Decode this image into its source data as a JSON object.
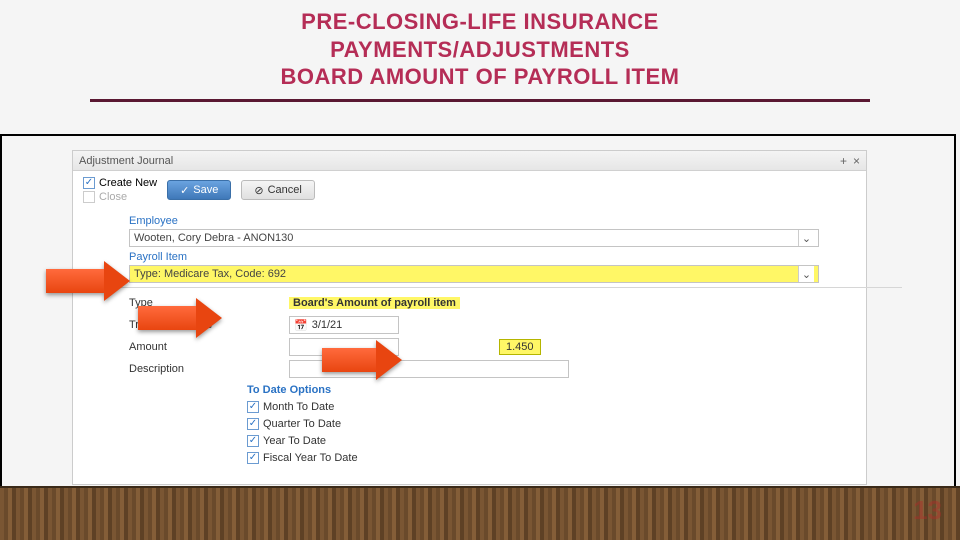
{
  "slide": {
    "title_line1": "PRE-CLOSING-LIFE INSURANCE",
    "title_line2": "PAYMENTS/ADJUSTMENTS",
    "title_line3": "BOARD AMOUNT OF PAYROLL ITEM",
    "page_number": "13"
  },
  "window": {
    "title": "Adjustment Journal"
  },
  "toolbar": {
    "create_new_label": "Create New",
    "close_label": "Close",
    "save_label": "Save",
    "cancel_label": "Cancel"
  },
  "form": {
    "employee_label": "Employee",
    "employee_value": "Wooten, Cory Debra - ANON130",
    "payroll_item_label": "Payroll Item",
    "payroll_item_value": "Type: Medicare Tax, Code: 692",
    "type_label": "Type",
    "type_value": "Board's Amount of payroll item",
    "txn_date_label": "Transaction Date",
    "txn_date_value": "3/1/21",
    "amount_label": "Amount",
    "amount_value": "1.450",
    "description_label": "Description",
    "to_date_header": "To Date Options",
    "opts": {
      "mtd": "Month To Date",
      "qtd": "Quarter To Date",
      "ytd": "Year To Date",
      "fytd": "Fiscal Year To Date"
    }
  }
}
